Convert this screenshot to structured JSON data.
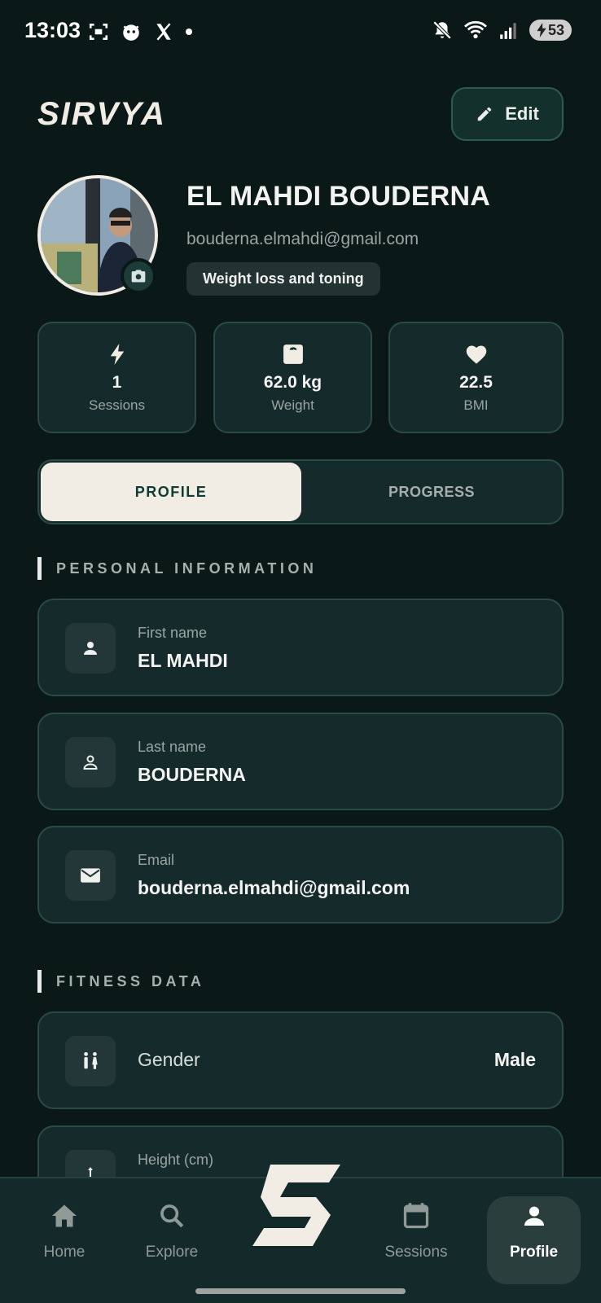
{
  "status_bar": {
    "time": "13:03",
    "battery": "53"
  },
  "header": {
    "logo_text": "SIRVYA",
    "edit_label": "Edit"
  },
  "profile": {
    "name": "EL MAHDI BOUDERNA",
    "email": "bouderna.elmahdi@gmail.com",
    "goal": "Weight loss and toning"
  },
  "stats": [
    {
      "icon": "lightning-icon",
      "value": "1",
      "label": "Sessions"
    },
    {
      "icon": "scale-icon",
      "value": "62.0 kg",
      "label": "Weight"
    },
    {
      "icon": "heart-icon",
      "value": "22.5",
      "label": "BMI"
    }
  ],
  "tabs": {
    "profile": "PROFILE",
    "progress": "PROGRESS",
    "active": "PROFILE"
  },
  "personal_info": {
    "title": "PERSONAL INFORMATION",
    "fields": [
      {
        "icon": "person-icon",
        "label": "First name",
        "value": "EL MAHDI"
      },
      {
        "icon": "person-outline-icon",
        "label": "Last name",
        "value": "BOUDERNA"
      },
      {
        "icon": "mail-icon",
        "label": "Email",
        "value": "bouderna.elmahdi@gmail.com"
      }
    ]
  },
  "fitness_data": {
    "title": "FITNESS DATA",
    "fields": [
      {
        "icon": "gender-icon",
        "label": "Gender",
        "value": "Male"
      },
      {
        "icon": "height-icon",
        "label": "Height (cm)",
        "value": ""
      }
    ]
  },
  "nav": {
    "items": [
      {
        "icon": "home-icon",
        "label": "Home"
      },
      {
        "icon": "search-icon",
        "label": "Explore"
      },
      {
        "icon": "calendar-icon",
        "label": "Sessions"
      },
      {
        "icon": "profile-icon",
        "label": "Profile"
      }
    ],
    "active": "Profile"
  },
  "colors": {
    "background": "#0b1818",
    "card": "#152b2b",
    "accent": "#f1ece4",
    "accent_text": "#0f3d35"
  }
}
